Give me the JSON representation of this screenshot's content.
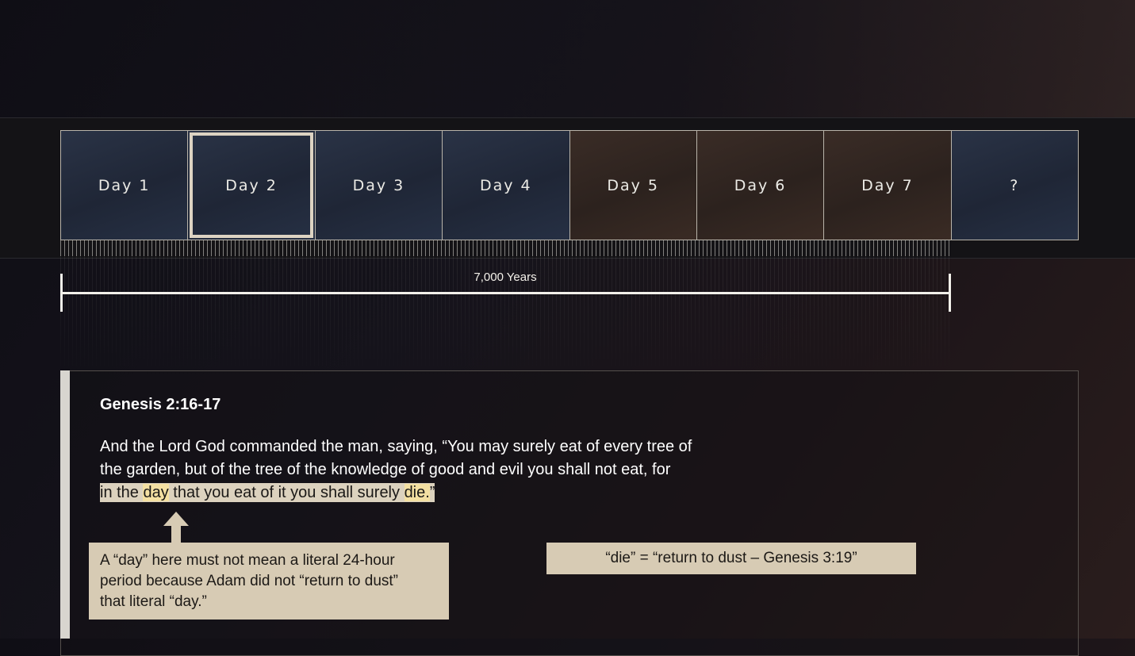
{
  "timeline": {
    "days": [
      {
        "label": "Day 1"
      },
      {
        "label": "Day 2"
      },
      {
        "label": "Day 3"
      },
      {
        "label": "Day 4"
      },
      {
        "label": "Day 5"
      },
      {
        "label": "Day 6"
      },
      {
        "label": "Day 7"
      },
      {
        "label": "?"
      }
    ],
    "span_label": "7,000 Years"
  },
  "scripture": {
    "reference": "Genesis 2:16-17",
    "line1": "And the Lord God commanded the man, saying, “You may surely eat of every tree of",
    "line2": "the garden, but of the tree of the knowledge of good and evil you shall not eat, for",
    "line3_a": "in the ",
    "line3_day": "day",
    "line3_b": " that you eat of it you shall surely ",
    "line3_die": "die.",
    "line3_c": "”"
  },
  "notes": {
    "day_note_line1": "A “day” here must not mean a literal 24-hour",
    "day_note_line2": "period because Adam did not “return to dust”",
    "day_note_line3": "that literal “day.”",
    "die_note": "“die” = “return to dust – Genesis 3:19”"
  },
  "colors": {
    "highlight_band": "#dcd2be",
    "highlight_word": "#f4e0a2",
    "note_box": "#d7cbb4",
    "selected_border": "#ddd3c2"
  }
}
